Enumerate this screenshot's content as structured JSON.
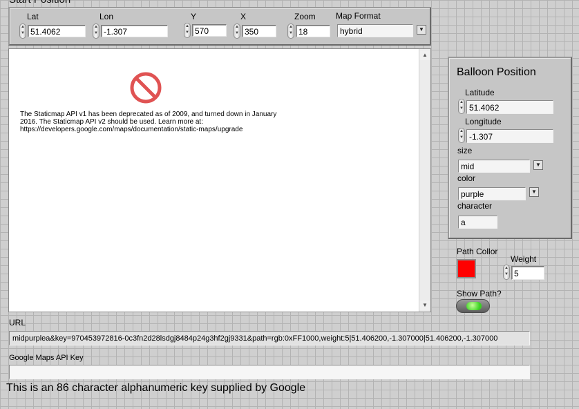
{
  "start_position": {
    "title": "Start Position",
    "lat": {
      "label": "Lat",
      "value": "51.4062"
    },
    "lon": {
      "label": "Lon",
      "value": "-1.307"
    },
    "y": {
      "label": "Y",
      "value": "570"
    },
    "x": {
      "label": "X",
      "value": "350"
    },
    "zoom": {
      "label": "Zoom",
      "value": "18"
    },
    "map_format": {
      "label": "Map Format",
      "value": "hybrid"
    }
  },
  "map_image": {
    "message": "The Staticmap API v1 has been deprecated as of 2009, and turned down in January 2016. The Staticmap API v2 should be used. Learn more at: https://developers.google.com/maps/documentation/static-maps/upgrade",
    "icon": "prohibited-icon"
  },
  "balloon": {
    "title": "Balloon Position",
    "latitude": {
      "label": "Latitude",
      "value": "51.4062"
    },
    "longitude": {
      "label": "Longitude",
      "value": "-1.307"
    },
    "size": {
      "label": "size",
      "value": "mid"
    },
    "color": {
      "label": "color",
      "value": "purple"
    },
    "character": {
      "label": "character",
      "value": "a"
    }
  },
  "path": {
    "color_label": "Path Collor",
    "color": "#ff0000",
    "weight_label": "Weight",
    "weight_value": "5",
    "show_label": "Show Path?",
    "led_color": "#33dd22"
  },
  "url": {
    "label": "URL",
    "value": "midpurplea&key=970453972816-0c3fn2d28lsdgj8484p24g3hf2gj9331&path=rgb:0xFF1000,weight:5|51.406200,-1.307000|51.406200,-1.307000"
  },
  "api_key": {
    "label": "Google Maps API Key",
    "value": "",
    "note": "This is an 86 character alphanumeric key supplied by Google"
  }
}
